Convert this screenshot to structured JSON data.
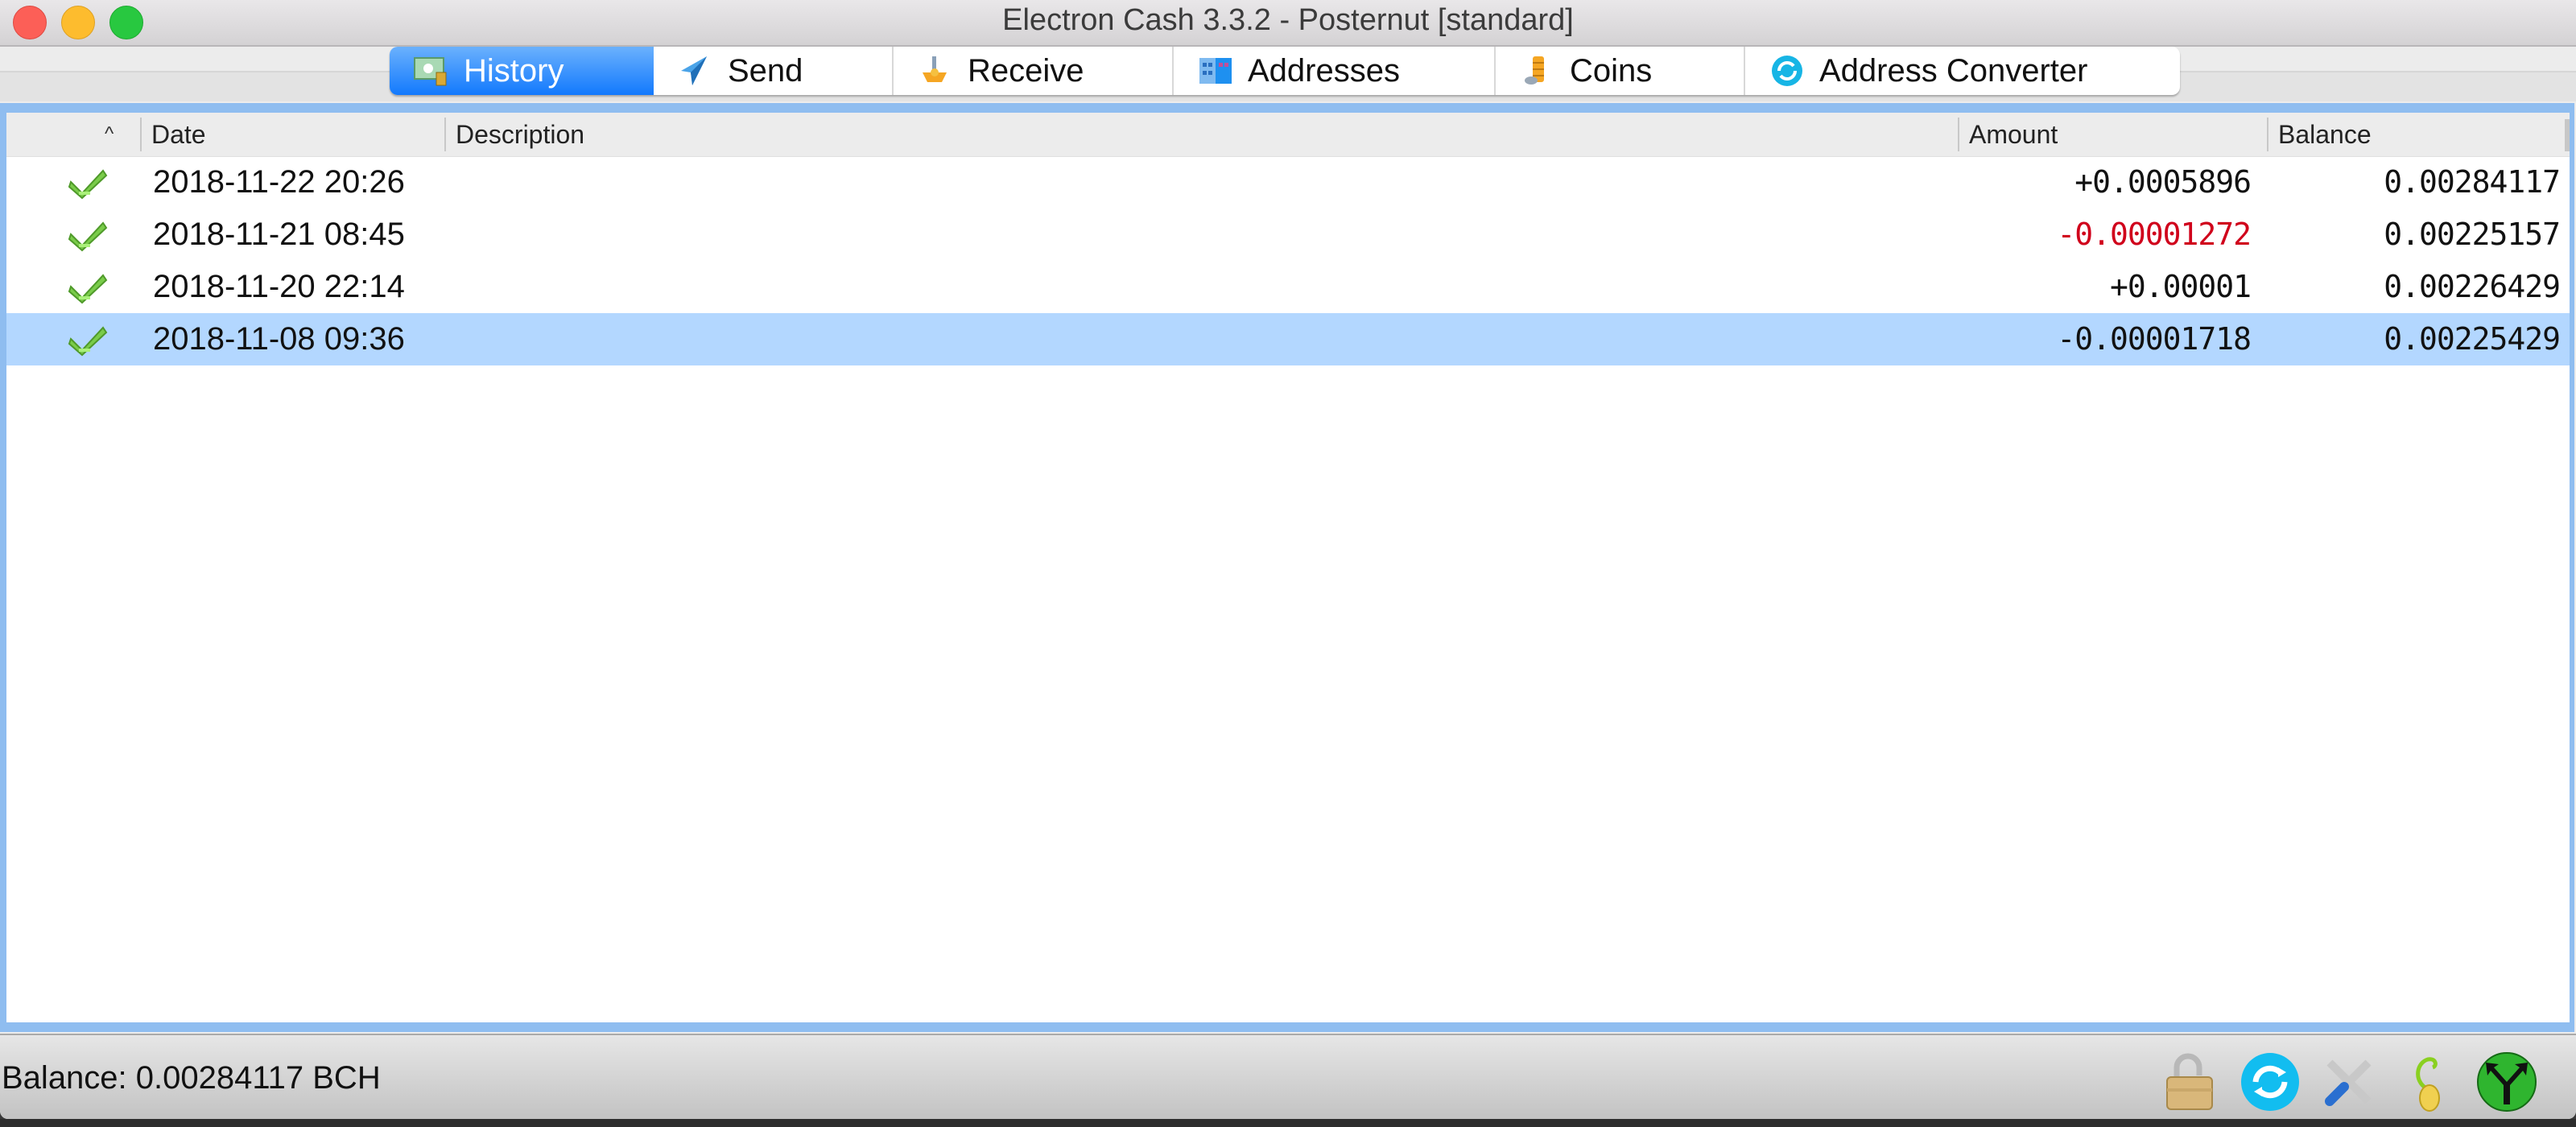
{
  "window": {
    "title": "Electron Cash 3.3.2  -  Posternut  [standard]",
    "traffic_lights": [
      "close",
      "minimize",
      "maximize"
    ]
  },
  "tabs": [
    {
      "label": "History",
      "icon": "history-icon",
      "active": true
    },
    {
      "label": "Send",
      "icon": "send-icon",
      "active": false
    },
    {
      "label": "Receive",
      "icon": "receive-icon",
      "active": false
    },
    {
      "label": "Addresses",
      "icon": "addresses-icon",
      "active": false
    },
    {
      "label": "Coins",
      "icon": "coins-icon",
      "active": false
    },
    {
      "label": "Address Converter",
      "icon": "address-converter-icon",
      "active": false
    }
  ],
  "history_table": {
    "sort_indicator": "^",
    "columns": [
      "",
      "Date",
      "Description",
      "Amount",
      "Balance"
    ],
    "rows": [
      {
        "status": "confirmed-check",
        "date": "2018-11-22 20:26",
        "description": "",
        "amount": "+0.0005896",
        "balance": "0.00284117",
        "negative": false,
        "selected": false
      },
      {
        "status": "confirmed-check",
        "date": "2018-11-21 08:45",
        "description": "",
        "amount": "-0.00001272",
        "balance": "0.00225157",
        "negative": true,
        "selected": false
      },
      {
        "status": "confirmed-check",
        "date": "2018-11-20 22:14",
        "description": "",
        "amount": "+0.00001",
        "balance": "0.00226429",
        "negative": false,
        "selected": false
      },
      {
        "status": "confirmed-check",
        "date": "2018-11-08 09:36",
        "description": "",
        "amount": "-0.00001718",
        "balance": "0.00225429",
        "negative": true,
        "selected": true
      }
    ]
  },
  "status_bar": {
    "balance_text": "Balance: 0.00284117 BCH",
    "icons": [
      "lock-open-icon",
      "network-sync-icon",
      "preferences-tools-icon",
      "seed-icon",
      "network-status-icon"
    ]
  },
  "colors": {
    "active_tab": "#1279fd",
    "selection": "#b3d7ff",
    "negative_amount": "#d0011b",
    "frame_focus": "#8fbdf0"
  }
}
